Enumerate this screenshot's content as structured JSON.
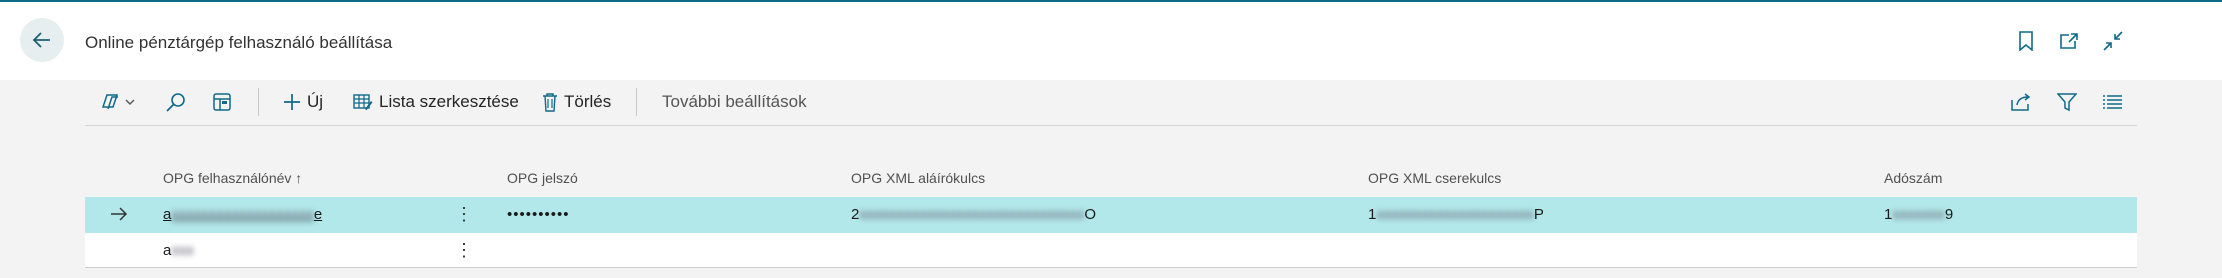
{
  "header": {
    "title": "Online pénztárgép felhasználó beállítása",
    "icons": [
      "back-arrow-icon",
      "bookmark-icon",
      "open-in-new-window-icon",
      "collapse-icon"
    ]
  },
  "actionbar": {
    "new_label": "Új",
    "edit_list_label": "Lista szerkesztése",
    "delete_label": "Törlés",
    "more_label": "További beállítások"
  },
  "grid": {
    "columns": [
      "OPG felhasználónév",
      "OPG jelszó",
      "OPG XML aláírókulcs",
      "OPG XML cserekulcs",
      "Adószám"
    ],
    "sort_indicator": "↑",
    "rows": [
      {
        "selected": true,
        "username_visible_start": "a",
        "username_visible_end": "e",
        "password": "••••••••••",
        "sign_key_visible_start": "2",
        "sign_key_visible_end": "O",
        "exchange_key_visible_start": "1",
        "exchange_key_visible_end": "P",
        "tax_number_visible_start": "1",
        "tax_number_visible_end": "9"
      },
      {
        "selected": false,
        "username_visible_start": "a"
      }
    ]
  },
  "colors": {
    "accent": "#0f6a8a",
    "selected_row": "#b3e8ea",
    "icon_blue": "#0f6a8a"
  }
}
